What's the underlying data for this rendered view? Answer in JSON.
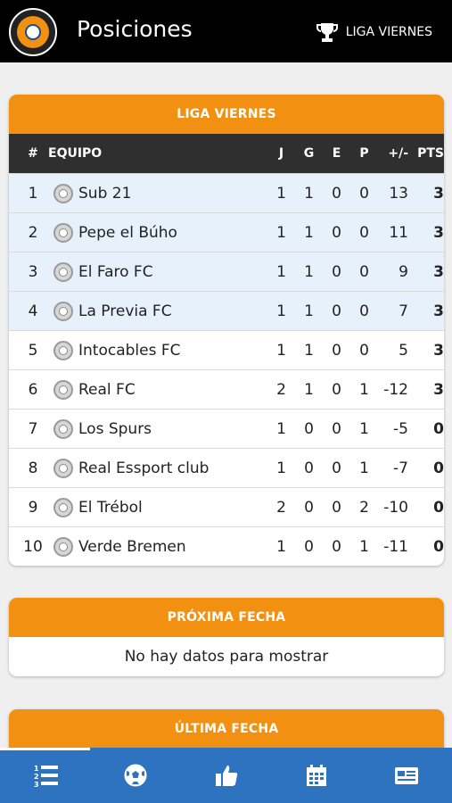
{
  "header": {
    "title": "Posiciones",
    "league_label": "LIGA VIERNES",
    "logo_icon": "club-crest-icon",
    "trophy_icon": "trophy-icon"
  },
  "standings": {
    "title": "LIGA VIERNES",
    "columns": [
      "#",
      "EQUIPO",
      "J",
      "G",
      "E",
      "P",
      "+/-",
      "PTS"
    ],
    "rows": [
      {
        "pos": "1",
        "team": "Sub 21",
        "j": "1",
        "g": "1",
        "e": "0",
        "p": "0",
        "dif": "13",
        "pts": "3"
      },
      {
        "pos": "2",
        "team": "Pepe el Búho",
        "j": "1",
        "g": "1",
        "e": "0",
        "p": "0",
        "dif": "11",
        "pts": "3"
      },
      {
        "pos": "3",
        "team": "El Faro FC",
        "j": "1",
        "g": "1",
        "e": "0",
        "p": "0",
        "dif": "9",
        "pts": "3"
      },
      {
        "pos": "4",
        "team": "La Previa FC",
        "j": "1",
        "g": "1",
        "e": "0",
        "p": "0",
        "dif": "7",
        "pts": "3"
      },
      {
        "pos": "5",
        "team": "Intocables FC",
        "j": "1",
        "g": "1",
        "e": "0",
        "p": "0",
        "dif": "5",
        "pts": "3"
      },
      {
        "pos": "6",
        "team": "Real FC",
        "j": "2",
        "g": "1",
        "e": "0",
        "p": "1",
        "dif": "-12",
        "pts": "3"
      },
      {
        "pos": "7",
        "team": "Los Spurs",
        "j": "1",
        "g": "0",
        "e": "0",
        "p": "1",
        "dif": "-5",
        "pts": "0"
      },
      {
        "pos": "8",
        "team": "Real Essport club",
        "j": "1",
        "g": "0",
        "e": "0",
        "p": "1",
        "dif": "-7",
        "pts": "0"
      },
      {
        "pos": "9",
        "team": "El Trébol",
        "j": "2",
        "g": "0",
        "e": "0",
        "p": "2",
        "dif": "-10",
        "pts": "0"
      },
      {
        "pos": "10",
        "team": "Verde Bremen",
        "j": "1",
        "g": "0",
        "e": "0",
        "p": "1",
        "dif": "-11",
        "pts": "0"
      }
    ]
  },
  "next_round": {
    "title": "PRÓXIMA FECHA",
    "empty_text": "No hay datos para mostrar"
  },
  "last_round": {
    "title": "ÚLTIMA FECHA"
  },
  "bottom_nav": {
    "items": [
      {
        "icon": "standings-list-icon",
        "active": true
      },
      {
        "icon": "soccer-ball-icon",
        "active": false
      },
      {
        "icon": "thumbs-up-icon",
        "active": false
      },
      {
        "icon": "calendar-icon",
        "active": false
      },
      {
        "icon": "news-icon",
        "active": false
      }
    ]
  },
  "colors": {
    "accent": "#f29111",
    "header_bg": "#000000",
    "table_head_bg": "#2f2f2f",
    "highlight_row": "#e6f1fb",
    "nav_bg": "#2e73bf"
  }
}
